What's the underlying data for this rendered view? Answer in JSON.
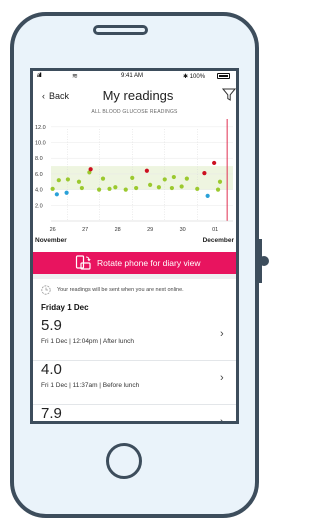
{
  "status_bar": {
    "signal": "all",
    "time": "9:41 AM",
    "battery": "✱ 100%"
  },
  "nav": {
    "back_label": "Back",
    "title": "My readings"
  },
  "chart": {
    "title": "ALL BLOOD GLUCOSE READINGS"
  },
  "chart_data": {
    "type": "scatter",
    "title": "ALL BLOOD GLUCOSE READINGS",
    "y_ticks": [
      "12.0",
      "10.0",
      "8.0",
      "6.0",
      "4.0",
      "2.0"
    ],
    "ylim": [
      0,
      13
    ],
    "x_ticks": [
      "26",
      "27",
      "28",
      "29",
      "30",
      "01"
    ],
    "x_month_labels": [
      "November",
      "December"
    ],
    "xlim": [
      0,
      5.6
    ],
    "target_band": [
      4.0,
      7.0
    ],
    "colors": {
      "in_range": "#9bc92e",
      "high": "#cc1020",
      "low": "#2aa1d8",
      "today_line": "#e03050",
      "band": "#eef5e0"
    },
    "points": [
      {
        "x": 0.05,
        "y": 4.1,
        "c": "in_range"
      },
      {
        "x": 0.18,
        "y": 3.4,
        "c": "low"
      },
      {
        "x": 0.24,
        "y": 5.2,
        "c": "in_range"
      },
      {
        "x": 0.48,
        "y": 3.6,
        "c": "low"
      },
      {
        "x": 0.52,
        "y": 5.3,
        "c": "in_range"
      },
      {
        "x": 0.86,
        "y": 5.0,
        "c": "in_range"
      },
      {
        "x": 0.95,
        "y": 4.2,
        "c": "in_range"
      },
      {
        "x": 1.18,
        "y": 6.2,
        "c": "in_range"
      },
      {
        "x": 1.22,
        "y": 6.6,
        "c": "high"
      },
      {
        "x": 1.48,
        "y": 4.0,
        "c": "in_range"
      },
      {
        "x": 1.6,
        "y": 5.4,
        "c": "in_range"
      },
      {
        "x": 1.8,
        "y": 4.1,
        "c": "in_range"
      },
      {
        "x": 1.98,
        "y": 4.3,
        "c": "in_range"
      },
      {
        "x": 2.3,
        "y": 4.0,
        "c": "in_range"
      },
      {
        "x": 2.5,
        "y": 5.5,
        "c": "in_range"
      },
      {
        "x": 2.62,
        "y": 4.2,
        "c": "in_range"
      },
      {
        "x": 2.95,
        "y": 6.4,
        "c": "high"
      },
      {
        "x": 3.05,
        "y": 4.6,
        "c": "in_range"
      },
      {
        "x": 3.32,
        "y": 4.3,
        "c": "in_range"
      },
      {
        "x": 3.5,
        "y": 5.3,
        "c": "in_range"
      },
      {
        "x": 3.72,
        "y": 4.2,
        "c": "in_range"
      },
      {
        "x": 3.78,
        "y": 5.6,
        "c": "in_range"
      },
      {
        "x": 4.02,
        "y": 4.4,
        "c": "in_range"
      },
      {
        "x": 4.18,
        "y": 5.4,
        "c": "in_range"
      },
      {
        "x": 4.5,
        "y": 4.1,
        "c": "in_range"
      },
      {
        "x": 4.72,
        "y": 6.1,
        "c": "high"
      },
      {
        "x": 4.82,
        "y": 3.2,
        "c": "low"
      },
      {
        "x": 5.02,
        "y": 7.4,
        "c": "high"
      },
      {
        "x": 5.14,
        "y": 4.0,
        "c": "in_range"
      },
      {
        "x": 5.2,
        "y": 5.0,
        "c": "in_range"
      }
    ],
    "today_x": 5.42
  },
  "rotate_banner": {
    "label": "Rotate phone for diary view"
  },
  "offline_note": "Your readings will be sent when you are next online.",
  "day_heading": "Friday 1 Dec",
  "entries": [
    {
      "value": "5.9",
      "meta": "Fri 1 Dec | 12:04pm | After lunch"
    },
    {
      "value": "4.0",
      "meta": "Fri 1 Dec | 11:37am | Before lunch"
    },
    {
      "value": "7.9",
      "meta": ""
    }
  ]
}
